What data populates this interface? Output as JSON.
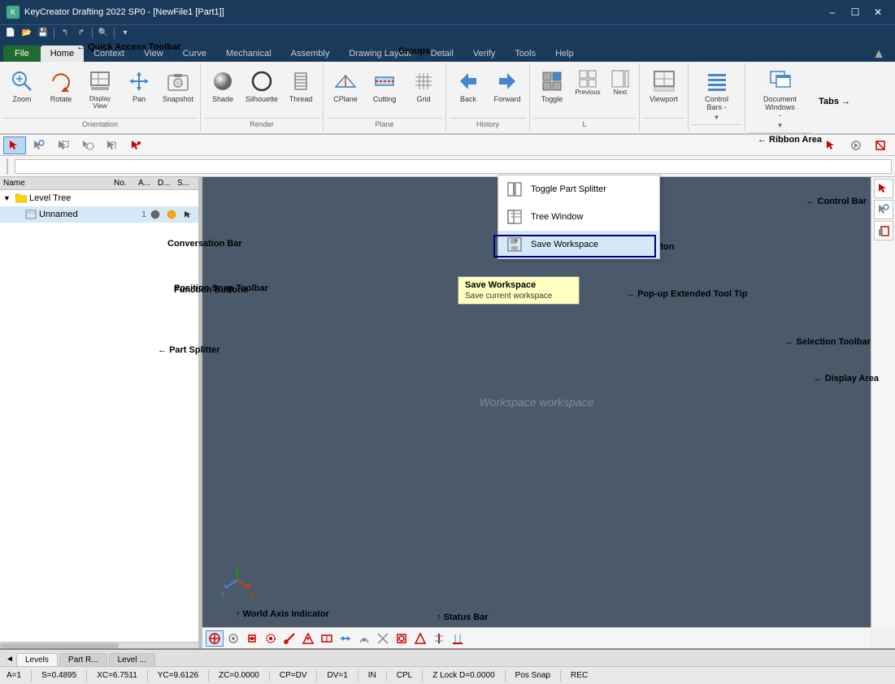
{
  "app": {
    "title": "KeyCreator Drafting 2022 SP0 - [NewFile1 [Part1]]",
    "titlebar_buttons": [
      "minimize",
      "maximize",
      "close"
    ]
  },
  "quick_access": {
    "label": "Quick Access Toolbar",
    "buttons": [
      "new",
      "open",
      "save",
      "undo",
      "redo",
      "print",
      "customize"
    ]
  },
  "ribbon_tabs": {
    "tabs": [
      "File",
      "Home",
      "Context",
      "View",
      "Curve",
      "Mechanical",
      "Assembly",
      "Drawing Layout",
      "Detail",
      "Verify",
      "Tools",
      "Help"
    ],
    "active": "Home",
    "label": "Tabs"
  },
  "ribbon_groups": {
    "orientation": {
      "label": "Orientation",
      "buttons": [
        "Zoom",
        "Rotate",
        "Display View",
        "Pan",
        "Snapshot"
      ]
    },
    "render": {
      "label": "Render",
      "buttons": [
        "Shade",
        "Silhouette",
        "Thread"
      ]
    },
    "plane": {
      "label": "Plane",
      "buttons": [
        "CPlane",
        "Cutting",
        "Grid"
      ]
    },
    "history": {
      "label": "History",
      "buttons": [
        "Back",
        "Forward"
      ]
    },
    "layout": {
      "label": "L",
      "buttons": [
        "Toggle",
        "Previous",
        "Next"
      ]
    },
    "viewport": {
      "label": "Viewport"
    },
    "control_bars": {
      "label": "Control Bars -"
    },
    "document_windows": {
      "label": "Document Windows -"
    }
  },
  "workspace_dropdown": {
    "items": [
      {
        "label": "Toggle Part Splitter",
        "icon": "grid-icon"
      },
      {
        "label": "Tree Window",
        "icon": "tree-icon"
      },
      {
        "label": "Save Workspace",
        "icon": "save-icon"
      }
    ]
  },
  "tooltip": {
    "title": "Save Workspace",
    "description": "Save current workspace"
  },
  "tree": {
    "columns": [
      "Name",
      "No.",
      "A...",
      "D...",
      "S..."
    ],
    "rows": [
      {
        "name": "Level Tree",
        "type": "folder",
        "indent": 0
      },
      {
        "name": "Unnamed",
        "number": "1",
        "type": "item",
        "indent": 1
      }
    ]
  },
  "position_snap_toolbar": {
    "label": "Position Snap Toolbar",
    "buttons": [
      "snap1",
      "snap2",
      "snap3",
      "snap4",
      "snap5",
      "snap6",
      "snap7",
      "snap8",
      "snap9",
      "snap10",
      "snap11",
      "snap12",
      "snap13",
      "snap14"
    ]
  },
  "conversation_bar": {
    "label": "Conversation Bar",
    "placeholder": ""
  },
  "control_bar_label": "Control Bar",
  "selection_toolbar_label": "Selection Toolbar",
  "display_area_label": "Display Area",
  "part_splitter_label": "Part Splitter",
  "function_buttons_label": "Function Buttons",
  "popup_tooltip_label": "Pop-up Extended Tool Tip",
  "split_button_label": "Split Button",
  "ribbon_area_label": "Ribbon Area",
  "world_axis_label": "World Axis Indicator",
  "status_bar_label": "Status Bar",
  "workspace_text": "Workspace workspace",
  "status_bar": {
    "items": [
      "A=1",
      "S=0.4895",
      "XC=6.7511",
      "YC=9.6126",
      "ZC=0.0000",
      "CP=DV",
      "DV=1",
      "IN",
      "CPL",
      "Z Lock D=0.0000",
      "Pos Snap",
      "REC"
    ]
  },
  "bottom_tabs": {
    "tabs": [
      "Levels",
      "Part R...",
      "Level ..."
    ]
  },
  "groups_label": "Groups"
}
